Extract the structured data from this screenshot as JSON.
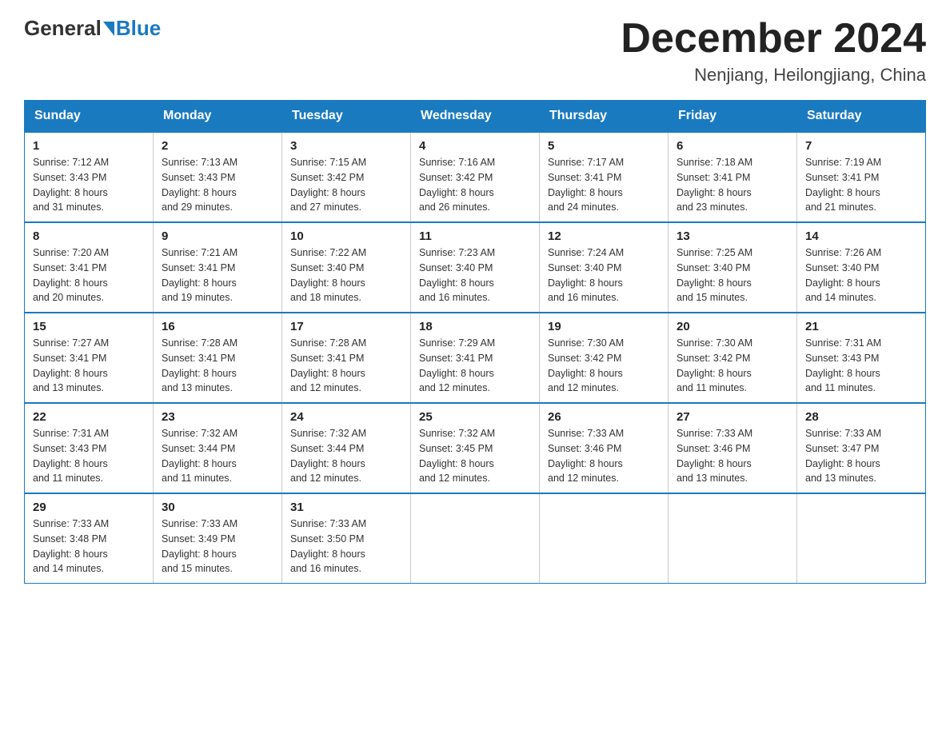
{
  "logo": {
    "general": "General",
    "arrow": "▶",
    "blue": "Blue"
  },
  "header": {
    "month_title": "December 2024",
    "location": "Nenjiang, Heilongjiang, China"
  },
  "weekdays": [
    "Sunday",
    "Monday",
    "Tuesday",
    "Wednesday",
    "Thursday",
    "Friday",
    "Saturday"
  ],
  "weeks": [
    [
      {
        "day": "1",
        "sunrise": "7:12 AM",
        "sunset": "3:43 PM",
        "daylight": "8 hours and 31 minutes."
      },
      {
        "day": "2",
        "sunrise": "7:13 AM",
        "sunset": "3:43 PM",
        "daylight": "8 hours and 29 minutes."
      },
      {
        "day": "3",
        "sunrise": "7:15 AM",
        "sunset": "3:42 PM",
        "daylight": "8 hours and 27 minutes."
      },
      {
        "day": "4",
        "sunrise": "7:16 AM",
        "sunset": "3:42 PM",
        "daylight": "8 hours and 26 minutes."
      },
      {
        "day": "5",
        "sunrise": "7:17 AM",
        "sunset": "3:41 PM",
        "daylight": "8 hours and 24 minutes."
      },
      {
        "day": "6",
        "sunrise": "7:18 AM",
        "sunset": "3:41 PM",
        "daylight": "8 hours and 23 minutes."
      },
      {
        "day": "7",
        "sunrise": "7:19 AM",
        "sunset": "3:41 PM",
        "daylight": "8 hours and 21 minutes."
      }
    ],
    [
      {
        "day": "8",
        "sunrise": "7:20 AM",
        "sunset": "3:41 PM",
        "daylight": "8 hours and 20 minutes."
      },
      {
        "day": "9",
        "sunrise": "7:21 AM",
        "sunset": "3:41 PM",
        "daylight": "8 hours and 19 minutes."
      },
      {
        "day": "10",
        "sunrise": "7:22 AM",
        "sunset": "3:40 PM",
        "daylight": "8 hours and 18 minutes."
      },
      {
        "day": "11",
        "sunrise": "7:23 AM",
        "sunset": "3:40 PM",
        "daylight": "8 hours and 16 minutes."
      },
      {
        "day": "12",
        "sunrise": "7:24 AM",
        "sunset": "3:40 PM",
        "daylight": "8 hours and 16 minutes."
      },
      {
        "day": "13",
        "sunrise": "7:25 AM",
        "sunset": "3:40 PM",
        "daylight": "8 hours and 15 minutes."
      },
      {
        "day": "14",
        "sunrise": "7:26 AM",
        "sunset": "3:40 PM",
        "daylight": "8 hours and 14 minutes."
      }
    ],
    [
      {
        "day": "15",
        "sunrise": "7:27 AM",
        "sunset": "3:41 PM",
        "daylight": "8 hours and 13 minutes."
      },
      {
        "day": "16",
        "sunrise": "7:28 AM",
        "sunset": "3:41 PM",
        "daylight": "8 hours and 13 minutes."
      },
      {
        "day": "17",
        "sunrise": "7:28 AM",
        "sunset": "3:41 PM",
        "daylight": "8 hours and 12 minutes."
      },
      {
        "day": "18",
        "sunrise": "7:29 AM",
        "sunset": "3:41 PM",
        "daylight": "8 hours and 12 minutes."
      },
      {
        "day": "19",
        "sunrise": "7:30 AM",
        "sunset": "3:42 PM",
        "daylight": "8 hours and 12 minutes."
      },
      {
        "day": "20",
        "sunrise": "7:30 AM",
        "sunset": "3:42 PM",
        "daylight": "8 hours and 11 minutes."
      },
      {
        "day": "21",
        "sunrise": "7:31 AM",
        "sunset": "3:43 PM",
        "daylight": "8 hours and 11 minutes."
      }
    ],
    [
      {
        "day": "22",
        "sunrise": "7:31 AM",
        "sunset": "3:43 PM",
        "daylight": "8 hours and 11 minutes."
      },
      {
        "day": "23",
        "sunrise": "7:32 AM",
        "sunset": "3:44 PM",
        "daylight": "8 hours and 11 minutes."
      },
      {
        "day": "24",
        "sunrise": "7:32 AM",
        "sunset": "3:44 PM",
        "daylight": "8 hours and 12 minutes."
      },
      {
        "day": "25",
        "sunrise": "7:32 AM",
        "sunset": "3:45 PM",
        "daylight": "8 hours and 12 minutes."
      },
      {
        "day": "26",
        "sunrise": "7:33 AM",
        "sunset": "3:46 PM",
        "daylight": "8 hours and 12 minutes."
      },
      {
        "day": "27",
        "sunrise": "7:33 AM",
        "sunset": "3:46 PM",
        "daylight": "8 hours and 13 minutes."
      },
      {
        "day": "28",
        "sunrise": "7:33 AM",
        "sunset": "3:47 PM",
        "daylight": "8 hours and 13 minutes."
      }
    ],
    [
      {
        "day": "29",
        "sunrise": "7:33 AM",
        "sunset": "3:48 PM",
        "daylight": "8 hours and 14 minutes."
      },
      {
        "day": "30",
        "sunrise": "7:33 AM",
        "sunset": "3:49 PM",
        "daylight": "8 hours and 15 minutes."
      },
      {
        "day": "31",
        "sunrise": "7:33 AM",
        "sunset": "3:50 PM",
        "daylight": "8 hours and 16 minutes."
      },
      null,
      null,
      null,
      null
    ]
  ],
  "labels": {
    "sunrise": "Sunrise:",
    "sunset": "Sunset:",
    "daylight": "Daylight:"
  }
}
